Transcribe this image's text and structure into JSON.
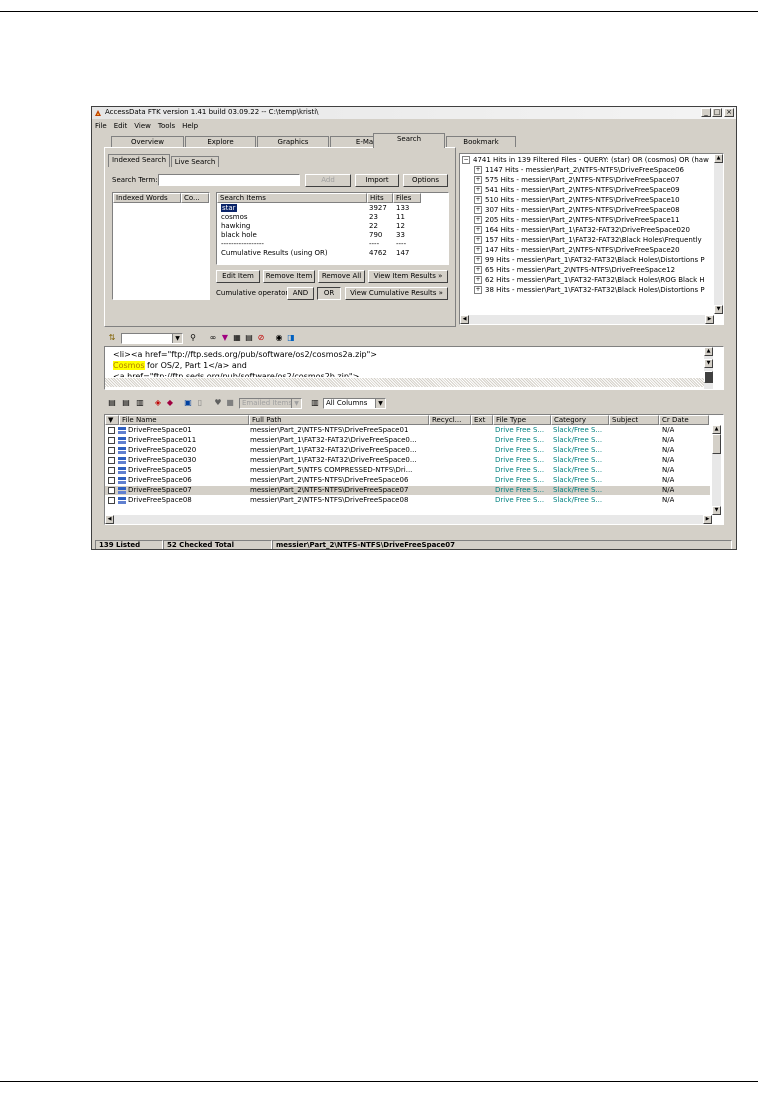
{
  "window": {
    "title": "AccessData FTK version 1.41 build 03.09.22 -- C:\\temp\\kristi\\",
    "minimize": "_",
    "maximize": "□",
    "close": "×"
  },
  "menu": [
    "File",
    "Edit",
    "View",
    "Tools",
    "Help"
  ],
  "tabs": [
    "Overview",
    "Explore",
    "Graphics",
    "E-Mail",
    "Search",
    "Bookmark"
  ],
  "search": {
    "subtabs": [
      "Indexed Search",
      "Live Search"
    ],
    "term_label": "Search Term:",
    "term_value": "",
    "add": "Add",
    "import": "Import",
    "options": "Options",
    "index_cols": [
      "Indexed Words",
      "Co..."
    ],
    "items_cols": [
      "Search Items",
      "Hits",
      "Files"
    ],
    "items": [
      {
        "term": "star",
        "hits": "3927",
        "files": "133"
      },
      {
        "term": "cosmos",
        "hits": "23",
        "files": "11"
      },
      {
        "term": "hawking",
        "hits": "22",
        "files": "12"
      },
      {
        "term": "black hole",
        "hits": "790",
        "files": "33"
      },
      {
        "term": "-----------------",
        "hits": "----",
        "files": "----"
      },
      {
        "term": "Cumulative Results (using OR)",
        "hits": "4762",
        "files": "147"
      }
    ],
    "edit_item": "Edit Item",
    "remove_item": "Remove Item",
    "remove_all": "Remove All",
    "view_item_results": "View Item Results »",
    "cumulative_label": "Cumulative operator:",
    "and": "AND",
    "or": "OR",
    "view_cumulative": "View Cumulative Results »"
  },
  "results_tree": {
    "header": "4741 Hits in 139 Filtered Files - QUERY: (star) OR (cosmos) OR (haw",
    "rows": [
      "1147 Hits - messier\\Part_2\\NTFS-NTFS\\DriveFreeSpace06",
      "575 Hits - messier\\Part_2\\NTFS-NTFS\\DriveFreeSpace07",
      "541 Hits - messier\\Part_2\\NTFS-NTFS\\DriveFreeSpace09",
      "510 Hits - messier\\Part_2\\NTFS-NTFS\\DriveFreeSpace10",
      "307 Hits - messier\\Part_2\\NTFS-NTFS\\DriveFreeSpace08",
      "205 Hits - messier\\Part_2\\NTFS-NTFS\\DriveFreeSpace11",
      "164 Hits - messier\\Part_1\\FAT32-FAT32\\DriveFreeSpace020",
      "157 Hits - messier\\Part_1\\FAT32-FAT32\\Black Holes\\Frequently",
      "147 Hits - messier\\Part_2\\NTFS-NTFS\\DriveFreeSpace20",
      "99 Hits - messier\\Part_1\\FAT32-FAT32\\Black Holes\\Distortions P",
      "65 Hits - messier\\Part_2\\NTFS-NTFS\\DriveFreeSpace12",
      "62 Hits - messier\\Part_1\\FAT32-FAT32\\Black Holes\\ROG Black H",
      "38 Hits - messier\\Part_1\\FAT32-FAT32\\Black Holes\\Distortions P"
    ]
  },
  "viewer": {
    "line1": "<li><a href=\"ftp://ftp.seds.org/pub/software/os2/cosmos2a.zip\">",
    "highlight": "Cosmos",
    "line2_rest": " for OS/2, Part 1</a> and",
    "line3": "<a href=\"ftp://ftp.seds.org/pub/software/os2/cosmos2b.zip\">"
  },
  "file_toolbar": {
    "emailed_items": "Emailed Items",
    "columns": "All Columns"
  },
  "file_list": {
    "columns": [
      "File Name",
      "Full Path",
      "Recycl...",
      "Ext",
      "File Type",
      "Category",
      "Subject",
      "Cr Date"
    ],
    "rows": [
      {
        "name": "DriveFreeSpace01",
        "path": "messier\\Part_2\\NTFS-NTFS\\DriveFreeSpace01",
        "type": "Drive Free S...",
        "category": "Slack/Free S...",
        "date": "N/A"
      },
      {
        "name": "DriveFreeSpace011",
        "path": "messier\\Part_1\\FAT32-FAT32\\DriveFreeSpace0...",
        "type": "Drive Free S...",
        "category": "Slack/Free S...",
        "date": "N/A"
      },
      {
        "name": "DriveFreeSpace020",
        "path": "messier\\Part_1\\FAT32-FAT32\\DriveFreeSpace0...",
        "type": "Drive Free S...",
        "category": "Slack/Free S...",
        "date": "N/A"
      },
      {
        "name": "DriveFreeSpace030",
        "path": "messier\\Part_1\\FAT32-FAT32\\DriveFreeSpace0...",
        "type": "Drive Free S...",
        "category": "Slack/Free S...",
        "date": "N/A"
      },
      {
        "name": "DriveFreeSpace05",
        "path": "messier\\Part_5\\NTFS COMPRESSED-NTFS\\Dri...",
        "type": "Drive Free S...",
        "category": "Slack/Free S...",
        "date": "N/A"
      },
      {
        "name": "DriveFreeSpace06",
        "path": "messier\\Part_2\\NTFS-NTFS\\DriveFreeSpace06",
        "type": "Drive Free S...",
        "category": "Slack/Free S...",
        "date": "N/A"
      },
      {
        "name": "DriveFreeSpace07",
        "path": "messier\\Part_2\\NTFS-NTFS\\DriveFreeSpace07",
        "type": "Drive Free S...",
        "category": "Slack/Free S...",
        "date": "N/A"
      },
      {
        "name": "DriveFreeSpace08",
        "path": "messier\\Part_2\\NTFS-NTFS\\DriveFreeSpace08",
        "type": "Drive Free S...",
        "category": "Slack/Free S...",
        "date": "N/A"
      }
    ]
  },
  "status": {
    "listed": "139 Listed",
    "checked": "52 Checked Total",
    "path": "messier\\Part_2\\NTFS-NTFS\\DriveFreeSpace07"
  },
  "colors": {
    "window_bg": "#d4d0c8",
    "highlight": "#ffff00",
    "teal": "#008080",
    "selection": "#0a246a"
  }
}
